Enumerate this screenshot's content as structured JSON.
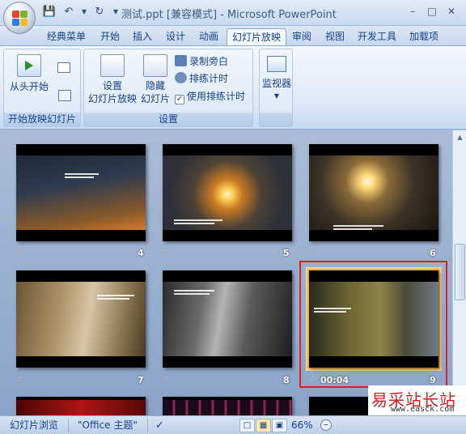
{
  "window": {
    "title": "测试.ppt [兼容模式] - Microsoft PowerPoint"
  },
  "qat": {
    "save_icon": "save-icon",
    "undo_icon": "undo-icon",
    "redo_icon": "redo-icon"
  },
  "tabs": [
    "经典菜单",
    "开始",
    "插入",
    "设计",
    "动画",
    "幻灯片放映",
    "审阅",
    "视图",
    "开发工具",
    "加载项"
  ],
  "ribbon": {
    "group1": {
      "label": "开始放映幻灯片",
      "from_start": "从头开始"
    },
    "group2": {
      "label": "设置",
      "setup_line1": "设置",
      "setup_line2": "幻灯片放映",
      "hide_line1": "隐藏",
      "hide_line2": "幻灯片",
      "record": "录制旁白",
      "rehearse": "排练计时",
      "use_timings": "使用排练计时",
      "use_timings_checked": true
    },
    "group3": {
      "monitors": "监视器"
    }
  },
  "slides": [
    {
      "num": "4",
      "star": "☆"
    },
    {
      "num": "5",
      "star": "☆"
    },
    {
      "num": "6",
      "star": "☆"
    },
    {
      "num": "7",
      "star": "☆"
    },
    {
      "num": "8",
      "star": "☆"
    },
    {
      "num": "9",
      "star": "☆",
      "time": "00:04",
      "selected": true
    }
  ],
  "status": {
    "view_name": "幻灯片浏览",
    "theme": "\"Office 主题\"",
    "zoom": "66%"
  },
  "watermark": {
    "line1": "易采站长站",
    "line2": "www.easck.com"
  }
}
